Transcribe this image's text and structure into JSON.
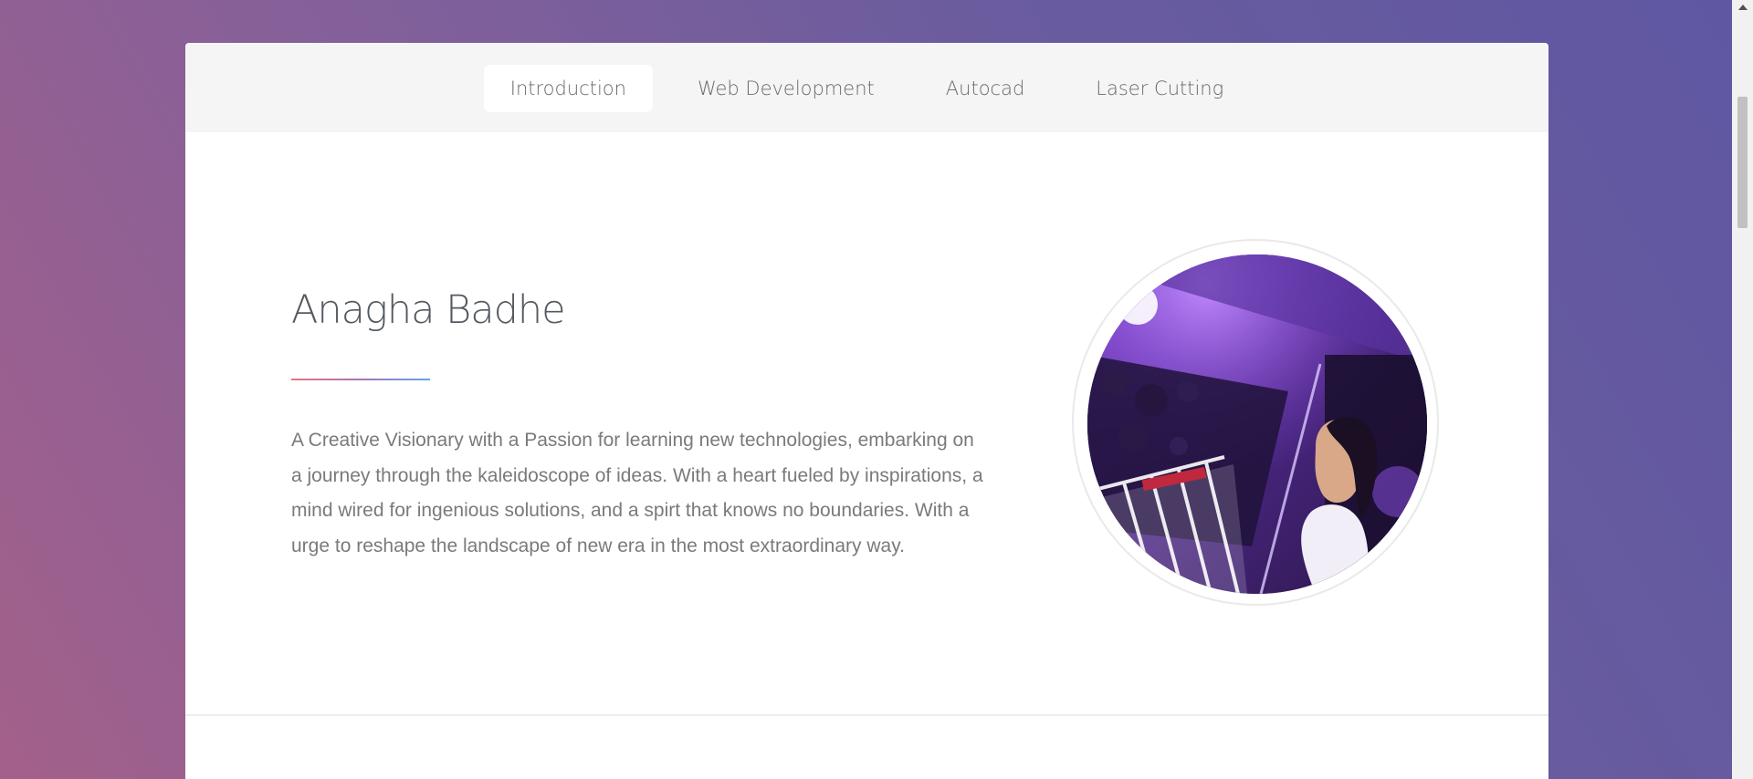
{
  "nav": {
    "tabs": [
      {
        "label": "Introduction",
        "active": true
      },
      {
        "label": "Web Development",
        "active": false
      },
      {
        "label": "Autocad",
        "active": false
      },
      {
        "label": "Laser Cutting",
        "active": false
      }
    ]
  },
  "intro": {
    "name": "Anagha Badhe",
    "bio": "A Creative Visionary with a Passion for learning new technologies, embarking on a journey through the kaleidoscope of ideas. With a heart fueled by inspirations, a mind wired for ingenious solutions, and a spirt that knows no boundaries. With a urge to reshape the landscape of new era in the most extraordinary way."
  },
  "theme": {
    "background_gradient": [
      "#a3608a",
      "#5f57a2"
    ],
    "accent_gradient": [
      "#e37682",
      "#5fa9e3"
    ],
    "text_color": "#7a7a7a",
    "title_color": "#555a61"
  }
}
